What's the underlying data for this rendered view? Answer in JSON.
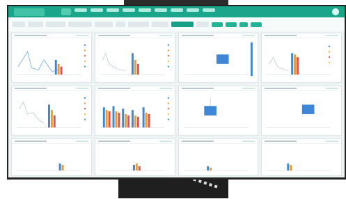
{
  "screen": {
    "header": {
      "nav_count": 10,
      "active_index": 0
    },
    "panels_count": 12
  }
}
